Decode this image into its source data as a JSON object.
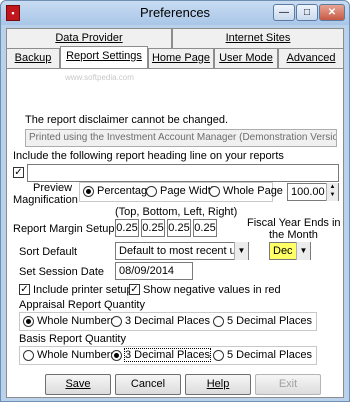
{
  "window": {
    "title": "Preferences",
    "icon": "app-red-icon"
  },
  "tabs": {
    "row1": [
      {
        "label": "Data Provider"
      },
      {
        "label": "Internet Sites"
      }
    ],
    "row2": [
      {
        "label": "Backup"
      },
      {
        "label": "Report Settings",
        "active": true
      },
      {
        "label": "Home Page"
      },
      {
        "label": "User Mode"
      },
      {
        "label": "Advanced"
      }
    ]
  },
  "watermark": "www.softpedia.com",
  "disclaimer": {
    "label": "The report disclaimer cannot be changed.",
    "value": "Printed using the Investment Account Manager (Demonstration Version)"
  },
  "heading": {
    "checkbox_label": "Include the following report heading line on your reports",
    "checked": true,
    "value": ""
  },
  "preview": {
    "label_line1": "Preview",
    "label_line2": "Magnification",
    "options": [
      "Percentage",
      "Page Width",
      "Whole Page"
    ],
    "selected": "Percentage",
    "value": "100.00"
  },
  "margins": {
    "header": "(Top,  Bottom, Left,  Right)",
    "label": "Report Margin Setup",
    "values": [
      "0.25",
      "0.25",
      "0.25",
      "0.25"
    ]
  },
  "fiscal": {
    "label_line1": "Fiscal Year Ends in",
    "label_line2": "the Month",
    "value": "Dec"
  },
  "sort": {
    "label": "Sort Default",
    "value": "Default to most recent use"
  },
  "session": {
    "label": "Set Session Date",
    "value": "08/09/2014"
  },
  "options": {
    "include_printer_setup": {
      "label": "Include printer setup",
      "checked": true
    },
    "show_negative_red": {
      "label": "Show negative values in red",
      "checked": true
    }
  },
  "appraisal": {
    "label": "Appraisal Report Quantity",
    "options": [
      "Whole Numbers",
      "3 Decimal Places",
      "5 Decimal Places"
    ],
    "selected": "Whole Numbers"
  },
  "basis": {
    "label": "Basis Report Quantity",
    "options": [
      "Whole Numbers",
      "3 Decimal Places",
      "5 Decimal Places"
    ],
    "selected": "3 Decimal Places"
  },
  "buttons": {
    "save": "Save",
    "cancel": "Cancel",
    "help": "Help",
    "exit": "Exit"
  },
  "colors": {
    "fiscal_highlight": "#ffff66",
    "title_bar": "#b9d1ea"
  }
}
